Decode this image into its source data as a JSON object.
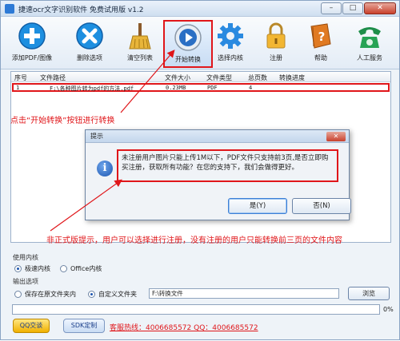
{
  "window": {
    "title": "捷速ocr文字识别软件 免费试用版 v1.2",
    "minimize": "–",
    "maximize": "□",
    "close": "✕"
  },
  "toolbar": {
    "items": [
      {
        "label": "添加PDF/图像",
        "icon": "plus-icon"
      },
      {
        "label": "删除选项",
        "icon": "delete-icon"
      },
      {
        "label": "清空列表",
        "icon": "broom-icon"
      },
      {
        "label": "开始转换",
        "icon": "play-icon"
      },
      {
        "label": "选择内核",
        "icon": "gear-icon"
      },
      {
        "label": "注册",
        "icon": "lock-icon"
      },
      {
        "label": "帮助",
        "icon": "help-book-icon"
      },
      {
        "label": "人工服务",
        "icon": "phone-icon"
      }
    ]
  },
  "file_table": {
    "columns": [
      "序号",
      "文件路径",
      "文件大小",
      "文件类型",
      "总页数",
      "转换进度"
    ],
    "rows": [
      {
        "index": "1",
        "path": "F:\\各种图片转为pdf的方法.pdf",
        "size": "0.23MB",
        "type": "PDF",
        "pages": "4",
        "progress": ""
      }
    ]
  },
  "annotations": {
    "click_start": "点击“开始转换”按钮进行转换",
    "unregistered": "非正式版提示，用户可以选择进行注册，没有注册的用户只能转换前三页的文件内容"
  },
  "dialog": {
    "title": "提示",
    "message": "未注册用户图片只能上传1M以下，PDF文件只支持前3页,是否立即购买注册，获取所有功能？在您的支持下，我们会做得更好。",
    "yes": "是(Y)",
    "no": "否(N)",
    "close": "✕"
  },
  "engine": {
    "heading": "使用内核",
    "options": [
      "极速内核",
      "Office内核"
    ],
    "selected": 0
  },
  "output": {
    "heading": "输出选项",
    "options": [
      "保存在原文件夹内",
      "自定义文件夹"
    ],
    "selected": 1,
    "path": "F:\\转换文件",
    "browse": "浏览"
  },
  "progress": {
    "value": 0,
    "label": "0%"
  },
  "footer": {
    "qq": "QQ交谈",
    "sdk": "SDK定制",
    "hotline": "客服热线：4006685572 QQ：4006685572"
  }
}
